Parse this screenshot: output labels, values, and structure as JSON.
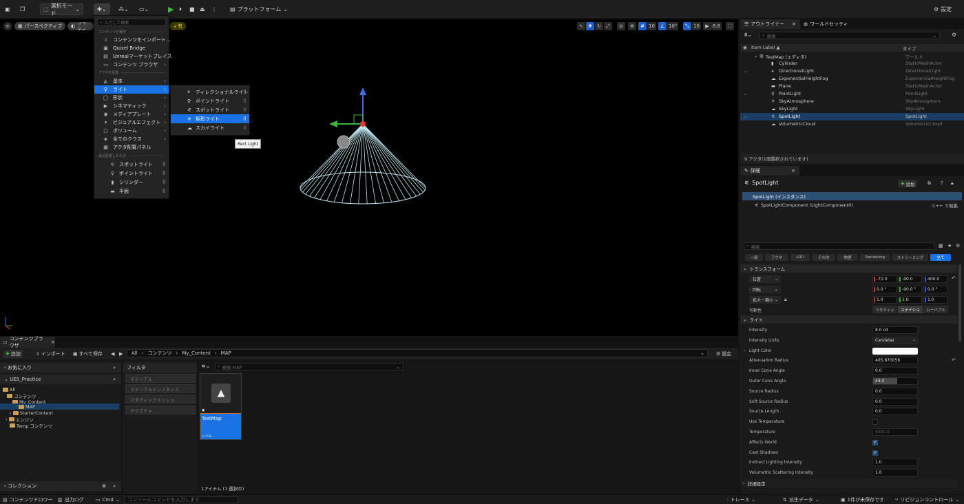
{
  "toolbar": {
    "mode_label": "選択モード",
    "platform_label": "プラットフォーム",
    "settings_label": "設定"
  },
  "viewport": {
    "perspective_label": "パースペクティブ",
    "lighting_label": "ライティ",
    "mode_badge": "ィ有",
    "grid_value": "10",
    "rot_value": "10°",
    "scale_value": "10",
    "camera_value": "8.8"
  },
  "menu": {
    "search_placeholder": "入力して検索",
    "section_content": "コンテンツを著作",
    "content_items": [
      "コンテンツをインポート...",
      "Quixel Bridge",
      "Unrealマーケットプレイス",
      "コンテンツ ブラウザ"
    ],
    "section_place": "アクタを配置",
    "place_items": [
      "基本",
      "ライト",
      "形状",
      "シネマティック",
      "メディアプレート",
      "ビジュアルエフェクト",
      "ボリューム",
      "全てのクラス",
      "アクタ配置パネル"
    ],
    "section_recent": "最近配置したもの",
    "recent_items": [
      "スポットライト",
      "ポイントライト",
      "シリンダー",
      "平面"
    ],
    "sub_items": [
      "ディレクショナルライト",
      "ポイントライト",
      "スポットライト",
      "矩形ライト",
      "スカイライト"
    ],
    "tooltip": "Rect Light"
  },
  "content_browser": {
    "tab_label": "コンテンツブラウザ",
    "add_label": "追加",
    "import_label": "インポート",
    "save_all_label": "すべて保存",
    "path": [
      "All",
      "コンテンツ",
      "My_Content",
      "MAP"
    ],
    "settings_label": "設定",
    "favorites_label": "お気に入り",
    "project_label": "UE5_Practice",
    "tree": [
      "All",
      "コンテンツ",
      "My_Content",
      "MAP",
      "StarterContent",
      "エンジン",
      "Temp コンテンツ"
    ],
    "collections_label": "コレクション",
    "filter_label": "フィルタ",
    "filters": [
      "マテリアル",
      "マテリアルインスタンス",
      "スタティックメッシュ",
      "テクスチャ"
    ],
    "search_placeholder": "検索 MAP",
    "asset_name": "TestMap",
    "asset_type": "レベル",
    "item_count": "1アイテム (1 選択中)"
  },
  "statusbar": {
    "drawer": "コンテンツドロワー",
    "output_log": "出力ログ",
    "cmd": "Cmd",
    "console_placeholder": "コンソールコマンドを入力します",
    "trace": "トレース",
    "derived_data": "派生データ",
    "unsaved": "1件が未保存です",
    "revision": "リビジョンコントロール"
  },
  "outliner": {
    "tab_label": "アウトライナー",
    "world_settings_tab": "ワールドセッティ",
    "search_placeholder": "検索",
    "col_label": "Item Label ▲",
    "col_type": "タイプ",
    "rows": [
      {
        "name": "TestMap (エディタ)",
        "type": "ワールド"
      },
      {
        "name": "Cylinder",
        "type": "StaticMeshActor"
      },
      {
        "name": "DirectionalLight",
        "type": "DirectionalLight"
      },
      {
        "name": "ExponentialHeightFog",
        "type": "ExponentialHeightFog"
      },
      {
        "name": "Plane",
        "type": "StaticMeshActor"
      },
      {
        "name": "PointLight",
        "type": "PointLight"
      },
      {
        "name": "SkyAtmosphere",
        "type": "SkyAtmosphere"
      },
      {
        "name": "SkyLight",
        "type": "SkyLight"
      },
      {
        "name": "SpotLight",
        "type": "SpotLight"
      },
      {
        "name": "VolumetricCloud",
        "type": "VolumetricCloud"
      }
    ],
    "footer": "9 アクタ(1個選択されています)"
  },
  "details": {
    "tab_label": "詳細",
    "actor_name": "SpotLight",
    "add_label": "追加",
    "instance_label": "SpotLight (インスタンス)",
    "component_label": "SpotLightComponent (LightComponent0)",
    "edit_cpp": "C++ で編集",
    "search_placeholder": "検索",
    "tabs": [
      "一般",
      "アクタ",
      "LOD",
      "その他",
      "物理",
      "Rendering",
      "ストリーミング",
      "全て"
    ],
    "transform_header": "トランスフォーム",
    "location_label": "位置",
    "rotation_label": "回転",
    "scale_label": "拡大・縮小",
    "location": [
      "-70.0",
      "-90.0",
      "400.0"
    ],
    "rotation": [
      "0.0 °",
      "-90.0 °",
      "0.0 °"
    ],
    "scale": [
      "1.0",
      "1.0",
      "1.0"
    ],
    "mobility_label": "可動性",
    "mobility_options": [
      "スタティッ",
      "ステイショ",
      "ムーバブル"
    ],
    "light_header": "ライト",
    "props": [
      {
        "label": "Intensity",
        "value": "8.0 cd"
      },
      {
        "label": "Intensity Units",
        "value": "Candelas"
      },
      {
        "label": "Light Color",
        "value": ""
      },
      {
        "label": "Attenuation Radius",
        "value": "405.870056"
      },
      {
        "label": "Inner Cone Angle",
        "value": "0.0"
      },
      {
        "label": "Outer Cone Angle",
        "value": "44.0"
      },
      {
        "label": "Source Radius",
        "value": "0.0"
      },
      {
        "label": "Soft Source Radius",
        "value": "0.0"
      },
      {
        "label": "Source Length",
        "value": "0.0"
      },
      {
        "label": "Use Temperature",
        "value": ""
      },
      {
        "label": "Temperature",
        "value": "6500.0"
      },
      {
        "label": "Affects World",
        "value": ""
      },
      {
        "label": "Cast Shadows",
        "value": ""
      },
      {
        "label": "Indirect Lighting Intensity",
        "value": "1.0"
      },
      {
        "label": "Volumetric Scattering Intensity",
        "value": "1.0"
      }
    ],
    "advanced_header": "詳細設定",
    "colors": {
      "accent": "#1a72e3",
      "selected_row": "#1a3d63",
      "light_cone": "#bfe7ef"
    }
  }
}
